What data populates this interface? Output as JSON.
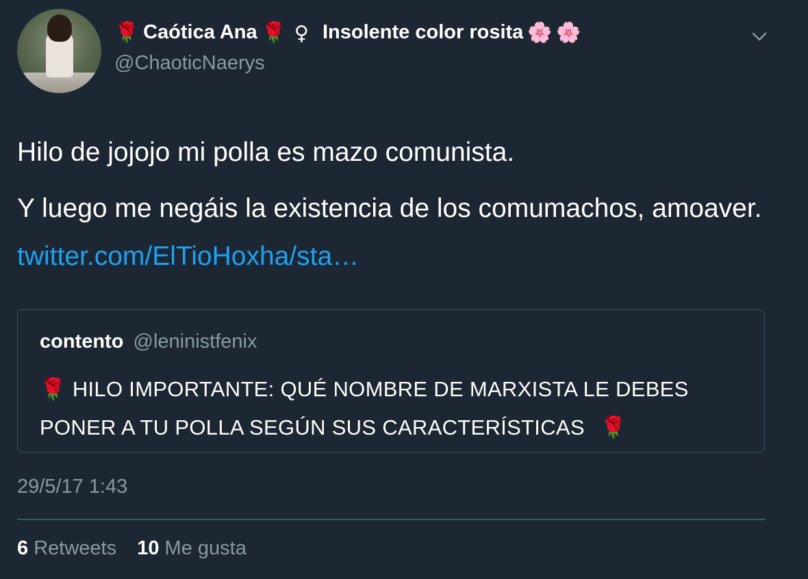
{
  "author": {
    "name_part1": "Caótica Ana",
    "name_part2": "Insolente color rosita",
    "rose_emoji": "🌹",
    "female_sign": "♀",
    "blossom_emoji": "🌸",
    "handle": "@ChaoticNaerys"
  },
  "tweet": {
    "paragraph1": "Hilo de jojojo mi polla es mazo comunista.",
    "paragraph2_text": "Y luego me negáis la existencia de los comumachos, amoaver.",
    "link": "twitter.com/ElTioHoxha/sta…"
  },
  "quoted": {
    "name": "contento",
    "handle": "@leninistfenix",
    "rose_emoji": "🌹",
    "text": "HILO IMPORTANTE: QUÉ NOMBRE DE MARXISTA LE DEBES PONER A TU POLLA SEGÚN SUS CARACTERÍSTICAS"
  },
  "timestamp": "29/5/17 1:43",
  "stats": {
    "retweets_count": "6",
    "retweets_label": "Retweets",
    "likes_count": "10",
    "likes_label": "Me gusta"
  },
  "colors": {
    "background": "#1c2733",
    "text": "#ffffff",
    "muted": "#8899a6",
    "link": "#1da1f2",
    "border": "#3d5466"
  },
  "icons": {
    "menu": "chevron-down-icon"
  }
}
